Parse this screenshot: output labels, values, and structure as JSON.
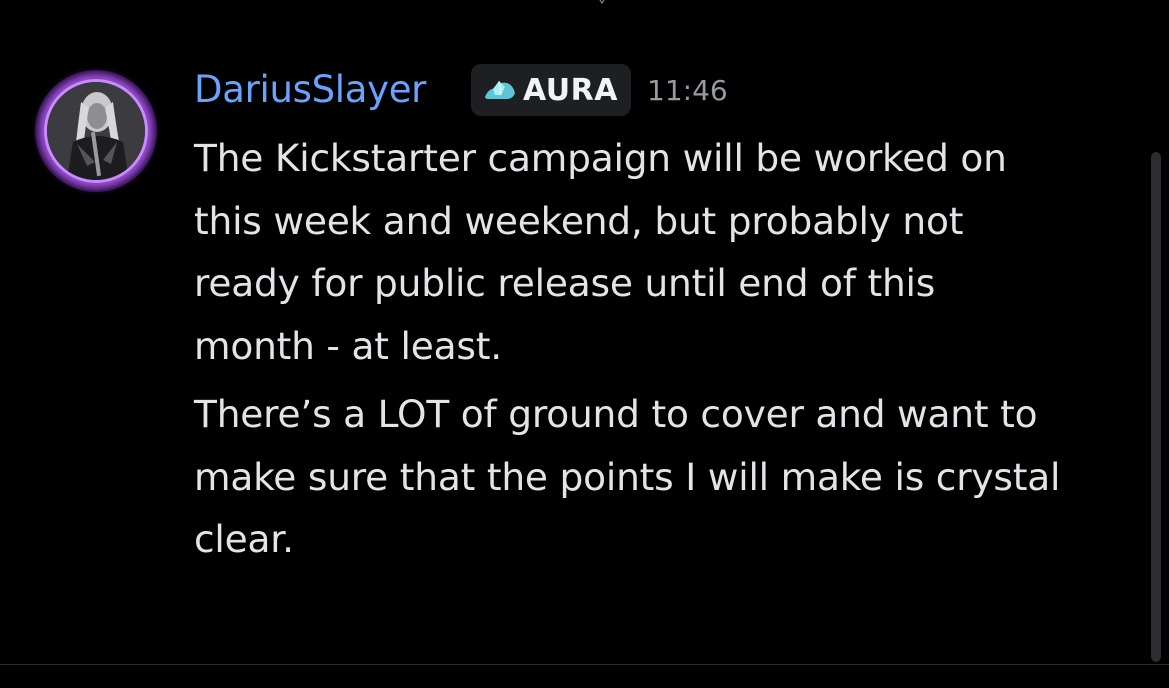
{
  "message": {
    "username": "DariusSlayer",
    "tag_label": "AURA",
    "tag_icon": "aura-crystal-icon",
    "timestamp": "11:46",
    "paragraphs": [
      "The Kickstarter campaign will be worked on\nthis week and weekend, but probably not\nready for public release until end of this\nmonth - at least.",
      "There’s a LOT of ground to cover and want to\nmake sure that the points I will make is crystal\nclear."
    ]
  },
  "colors": {
    "background": "#000000",
    "username": "#6aa3ff",
    "text": "#e3e4e8",
    "timestamp": "#949ba4",
    "tag_background": "#1e1f22",
    "avatar_ring": "#c98bff",
    "tag_icon": "#7fd8e6"
  }
}
